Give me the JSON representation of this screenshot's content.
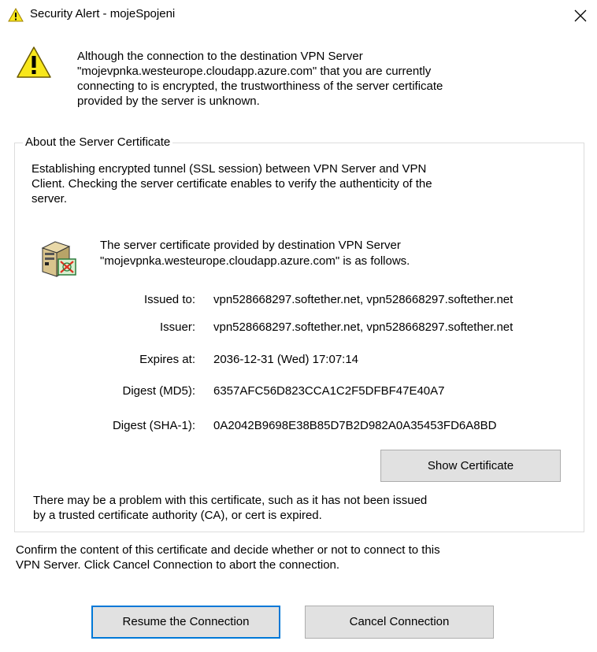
{
  "window": {
    "title": "Security Alert - mojeSpojeni",
    "close_icon": "close-icon",
    "title_icon": "warning-triangle-icon"
  },
  "alert": {
    "icon": "warning-triangle-icon",
    "lines": [
      "Although the connection to the destination VPN Server",
      "\"mojevpnka.westeurope.cloudapp.azure.com\" that you are currently",
      "connecting to is encrypted, the trustworthiness of the server certificate",
      "provided by the server is unknown."
    ]
  },
  "cert_group": {
    "legend": "About the Server Certificate",
    "intro_lines": [
      "Establishing encrypted tunnel (SSL session) between VPN Server and VPN",
      "Client. Checking the server certificate enables to verify the authenticity of the",
      "server."
    ],
    "server_icon": "server-certificate-icon",
    "lead_lines": [
      "The server certificate provided by destination VPN Server",
      "\"mojevpnka.westeurope.cloudapp.azure.com\" is as follows."
    ],
    "fields": {
      "issued_to": {
        "label": "Issued to:",
        "value": "vpn528668297.softether.net, vpn528668297.softether.net"
      },
      "issuer": {
        "label": "Issuer:",
        "value": "vpn528668297.softether.net, vpn528668297.softether.net"
      },
      "expires": {
        "label": "Expires at:",
        "value": "2036-12-31 (Wed) 17:07:14"
      },
      "md5": {
        "label": "Digest (MD5):",
        "value": "6357AFC56D823CCA1C2F5DFBF47E40A7"
      },
      "sha1": {
        "label": "Digest (SHA-1):",
        "value": "0A2042B9698E38B85D7B2D982A0A35453FD6A8BD"
      }
    },
    "show_certificate_label": "Show Certificate",
    "problem_lines": [
      "There may be a problem with this certificate, such as it has not been issued",
      "by a trusted certificate authority (CA), or cert is expired."
    ]
  },
  "confirm_lines": [
    "Confirm the content of this certificate and decide whether or not to connect to this",
    "VPN Server. Click Cancel Connection to abort the connection."
  ],
  "buttons": {
    "resume_label": "Resume the Connection",
    "cancel_label": "Cancel Connection"
  },
  "colors": {
    "accent": "#0078d7",
    "warning_yellow": "#f8e71c",
    "button_face": "#e1e1e1"
  }
}
